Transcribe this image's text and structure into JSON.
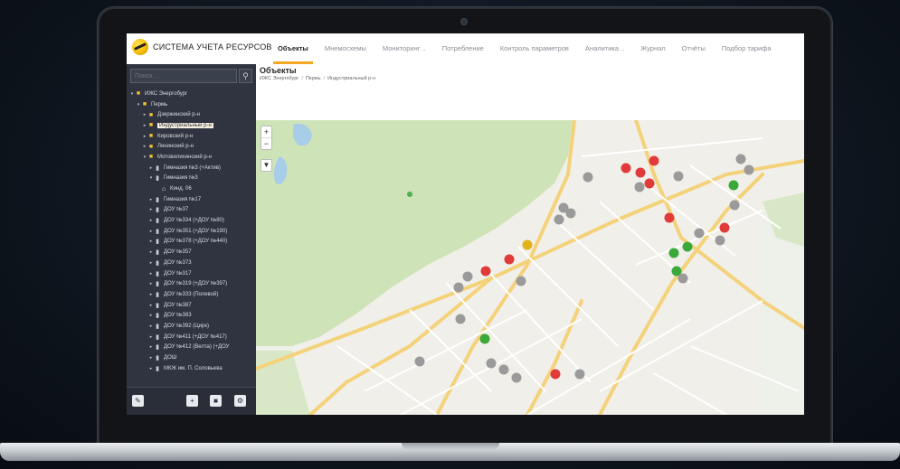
{
  "app": {
    "logo_text": "СИСТЕМА УЧЕТА РЕСУРСОВ"
  },
  "nav": {
    "items": [
      {
        "label": "Объекты",
        "active": true
      },
      {
        "label": "Мнемосхемы",
        "active": false
      },
      {
        "label": "Мониторинг ..",
        "active": false
      },
      {
        "label": "Потребление",
        "active": false
      },
      {
        "label": "Контроль параметров",
        "active": false
      },
      {
        "label": "Аналитика ..",
        "active": false
      },
      {
        "label": "Журнал",
        "active": false
      },
      {
        "label": "Отчёты",
        "active": false
      },
      {
        "label": "Подбор тарифа",
        "active": false
      }
    ]
  },
  "sidebar": {
    "search": {
      "placeholder": "Поиск ..."
    },
    "tree": [
      {
        "label": "ИЖС Энергобург",
        "depth": 0,
        "icon": "folder-icon",
        "arrow": "▾"
      },
      {
        "label": "Пермь",
        "depth": 1,
        "icon": "folder-icon",
        "arrow": "▾"
      },
      {
        "label": "Дзержинский р-н",
        "depth": 2,
        "icon": "folder-icon",
        "arrow": "▸"
      },
      {
        "label": "Индустриальный р-н",
        "depth": 2,
        "icon": "folder-icon",
        "arrow": "▸",
        "selected": true
      },
      {
        "label": "Кировский р-н",
        "depth": 2,
        "icon": "folder-icon",
        "arrow": "▸"
      },
      {
        "label": "Ленинский р-н",
        "depth": 2,
        "icon": "folder-icon",
        "arrow": "▸"
      },
      {
        "label": "Мотовилихинский р-н",
        "depth": 2,
        "icon": "folder-icon",
        "arrow": "▾"
      },
      {
        "label": "Гимназия №3 (+Актив)",
        "depth": 3,
        "icon": "document-icon",
        "arrow": "▸"
      },
      {
        "label": "Гимназия №3",
        "depth": 3,
        "icon": "document-icon",
        "arrow": "▾"
      },
      {
        "label": "Кинд. 06",
        "depth": 4,
        "icon": "home-icon",
        "arrow": ""
      },
      {
        "label": "Гимназия №17",
        "depth": 3,
        "icon": "document-icon",
        "arrow": "▸"
      },
      {
        "label": "ДОУ №37",
        "depth": 3,
        "icon": "document-icon",
        "arrow": "▸"
      },
      {
        "label": "ДОУ №334 (+ДОУ №80)",
        "depth": 3,
        "icon": "document-icon",
        "arrow": "▸"
      },
      {
        "label": "ДОУ №351 (+ДОУ №190)",
        "depth": 3,
        "icon": "document-icon",
        "arrow": "▸"
      },
      {
        "label": "ДОУ №378 (+ДОУ №440)",
        "depth": 3,
        "icon": "document-icon",
        "arrow": "▸"
      },
      {
        "label": "ДОУ №357",
        "depth": 3,
        "icon": "document-icon",
        "arrow": "▸"
      },
      {
        "label": "ДОУ №373",
        "depth": 3,
        "icon": "document-icon",
        "arrow": "▸"
      },
      {
        "label": "ДОУ №317",
        "depth": 3,
        "icon": "document-icon",
        "arrow": "▸"
      },
      {
        "label": "ДОУ №319 (+ДОУ №397)",
        "depth": 3,
        "icon": "document-icon",
        "arrow": "▸"
      },
      {
        "label": "ДОУ №333 (Полевой)",
        "depth": 3,
        "icon": "document-icon",
        "arrow": "▸"
      },
      {
        "label": "ДОУ №387",
        "depth": 3,
        "icon": "document-icon",
        "arrow": "▸"
      },
      {
        "label": "ДОУ №383",
        "depth": 3,
        "icon": "document-icon",
        "arrow": "▸"
      },
      {
        "label": "ДОУ №392 (Цирк)",
        "depth": 3,
        "icon": "document-icon",
        "arrow": "▸"
      },
      {
        "label": "ДОУ №411 (+ДОУ №417)",
        "depth": 3,
        "icon": "document-icon",
        "arrow": "▸"
      },
      {
        "label": "ДОУ №412 (Велта) (+ДОУ",
        "depth": 3,
        "icon": "document-icon",
        "arrow": "▸"
      },
      {
        "label": "ДОШ",
        "depth": 3,
        "icon": "document-icon",
        "arrow": "▸"
      },
      {
        "label": "МКЖ им. П. Соловьева",
        "depth": 3,
        "icon": "document-icon",
        "arrow": "▸"
      }
    ]
  },
  "content": {
    "title": "Объекты",
    "breadcrumb": [
      "ИЖС Энергобург",
      "Пермь",
      "Индустриальный р-н"
    ]
  },
  "map": {
    "colors": {
      "ok": "#3aa93a",
      "alarm": "#e03a3a",
      "warning": "#e2b21b",
      "offline": "#9a9a9a"
    },
    "zoom_in": "+",
    "zoom_out": "−",
    "filter": "▼"
  }
}
